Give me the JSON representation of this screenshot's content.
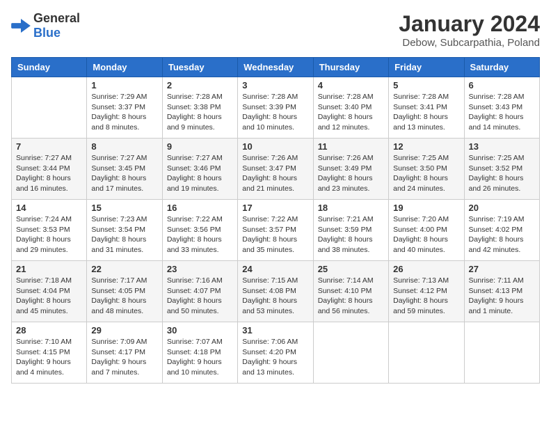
{
  "header": {
    "logo_general": "General",
    "logo_blue": "Blue",
    "month": "January 2024",
    "location": "Debow, Subcarpathia, Poland"
  },
  "days_of_week": [
    "Sunday",
    "Monday",
    "Tuesday",
    "Wednesday",
    "Thursday",
    "Friday",
    "Saturday"
  ],
  "weeks": [
    [
      {
        "num": "",
        "info": ""
      },
      {
        "num": "1",
        "info": "Sunrise: 7:29 AM\nSunset: 3:37 PM\nDaylight: 8 hours\nand 8 minutes."
      },
      {
        "num": "2",
        "info": "Sunrise: 7:28 AM\nSunset: 3:38 PM\nDaylight: 8 hours\nand 9 minutes."
      },
      {
        "num": "3",
        "info": "Sunrise: 7:28 AM\nSunset: 3:39 PM\nDaylight: 8 hours\nand 10 minutes."
      },
      {
        "num": "4",
        "info": "Sunrise: 7:28 AM\nSunset: 3:40 PM\nDaylight: 8 hours\nand 12 minutes."
      },
      {
        "num": "5",
        "info": "Sunrise: 7:28 AM\nSunset: 3:41 PM\nDaylight: 8 hours\nand 13 minutes."
      },
      {
        "num": "6",
        "info": "Sunrise: 7:28 AM\nSunset: 3:43 PM\nDaylight: 8 hours\nand 14 minutes."
      }
    ],
    [
      {
        "num": "7",
        "info": "Sunrise: 7:27 AM\nSunset: 3:44 PM\nDaylight: 8 hours\nand 16 minutes."
      },
      {
        "num": "8",
        "info": "Sunrise: 7:27 AM\nSunset: 3:45 PM\nDaylight: 8 hours\nand 17 minutes."
      },
      {
        "num": "9",
        "info": "Sunrise: 7:27 AM\nSunset: 3:46 PM\nDaylight: 8 hours\nand 19 minutes."
      },
      {
        "num": "10",
        "info": "Sunrise: 7:26 AM\nSunset: 3:47 PM\nDaylight: 8 hours\nand 21 minutes."
      },
      {
        "num": "11",
        "info": "Sunrise: 7:26 AM\nSunset: 3:49 PM\nDaylight: 8 hours\nand 23 minutes."
      },
      {
        "num": "12",
        "info": "Sunrise: 7:25 AM\nSunset: 3:50 PM\nDaylight: 8 hours\nand 24 minutes."
      },
      {
        "num": "13",
        "info": "Sunrise: 7:25 AM\nSunset: 3:52 PM\nDaylight: 8 hours\nand 26 minutes."
      }
    ],
    [
      {
        "num": "14",
        "info": "Sunrise: 7:24 AM\nSunset: 3:53 PM\nDaylight: 8 hours\nand 29 minutes."
      },
      {
        "num": "15",
        "info": "Sunrise: 7:23 AM\nSunset: 3:54 PM\nDaylight: 8 hours\nand 31 minutes."
      },
      {
        "num": "16",
        "info": "Sunrise: 7:22 AM\nSunset: 3:56 PM\nDaylight: 8 hours\nand 33 minutes."
      },
      {
        "num": "17",
        "info": "Sunrise: 7:22 AM\nSunset: 3:57 PM\nDaylight: 8 hours\nand 35 minutes."
      },
      {
        "num": "18",
        "info": "Sunrise: 7:21 AM\nSunset: 3:59 PM\nDaylight: 8 hours\nand 38 minutes."
      },
      {
        "num": "19",
        "info": "Sunrise: 7:20 AM\nSunset: 4:00 PM\nDaylight: 8 hours\nand 40 minutes."
      },
      {
        "num": "20",
        "info": "Sunrise: 7:19 AM\nSunset: 4:02 PM\nDaylight: 8 hours\nand 42 minutes."
      }
    ],
    [
      {
        "num": "21",
        "info": "Sunrise: 7:18 AM\nSunset: 4:04 PM\nDaylight: 8 hours\nand 45 minutes."
      },
      {
        "num": "22",
        "info": "Sunrise: 7:17 AM\nSunset: 4:05 PM\nDaylight: 8 hours\nand 48 minutes."
      },
      {
        "num": "23",
        "info": "Sunrise: 7:16 AM\nSunset: 4:07 PM\nDaylight: 8 hours\nand 50 minutes."
      },
      {
        "num": "24",
        "info": "Sunrise: 7:15 AM\nSunset: 4:08 PM\nDaylight: 8 hours\nand 53 minutes."
      },
      {
        "num": "25",
        "info": "Sunrise: 7:14 AM\nSunset: 4:10 PM\nDaylight: 8 hours\nand 56 minutes."
      },
      {
        "num": "26",
        "info": "Sunrise: 7:13 AM\nSunset: 4:12 PM\nDaylight: 8 hours\nand 59 minutes."
      },
      {
        "num": "27",
        "info": "Sunrise: 7:11 AM\nSunset: 4:13 PM\nDaylight: 9 hours\nand 1 minute."
      }
    ],
    [
      {
        "num": "28",
        "info": "Sunrise: 7:10 AM\nSunset: 4:15 PM\nDaylight: 9 hours\nand 4 minutes."
      },
      {
        "num": "29",
        "info": "Sunrise: 7:09 AM\nSunset: 4:17 PM\nDaylight: 9 hours\nand 7 minutes."
      },
      {
        "num": "30",
        "info": "Sunrise: 7:07 AM\nSunset: 4:18 PM\nDaylight: 9 hours\nand 10 minutes."
      },
      {
        "num": "31",
        "info": "Sunrise: 7:06 AM\nSunset: 4:20 PM\nDaylight: 9 hours\nand 13 minutes."
      },
      {
        "num": "",
        "info": ""
      },
      {
        "num": "",
        "info": ""
      },
      {
        "num": "",
        "info": ""
      }
    ]
  ]
}
